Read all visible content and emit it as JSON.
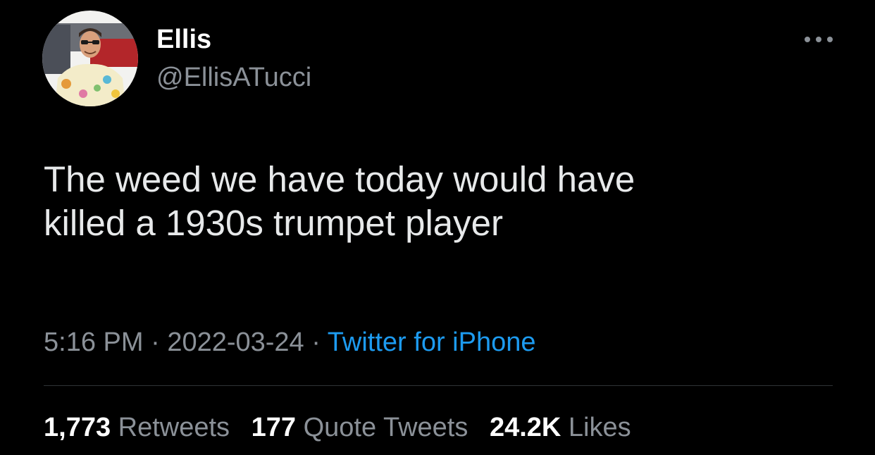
{
  "author": {
    "display_name": "Ellis",
    "handle": "@EllisATucci",
    "avatar_icon": "profile-photo"
  },
  "more_icon": "more-horizontal-icon",
  "tweet": {
    "lines": [
      "The weed we have today would have",
      "killed a 1930s trumpet player"
    ],
    "time": "5:16 PM",
    "separator": "·",
    "date": "2022-03-24",
    "source": "Twitter for iPhone"
  },
  "stats": {
    "retweets": {
      "count": "1,773",
      "label": "Retweets"
    },
    "quote_tweets": {
      "count": "177",
      "label": "Quote Tweets"
    },
    "likes": {
      "count": "24.2K",
      "label": "Likes"
    }
  },
  "colors": {
    "background": "#000000",
    "text": "#e7e9ea",
    "secondary_text": "#8b9198",
    "link": "#1d9bf0",
    "divider": "#2f3336"
  }
}
